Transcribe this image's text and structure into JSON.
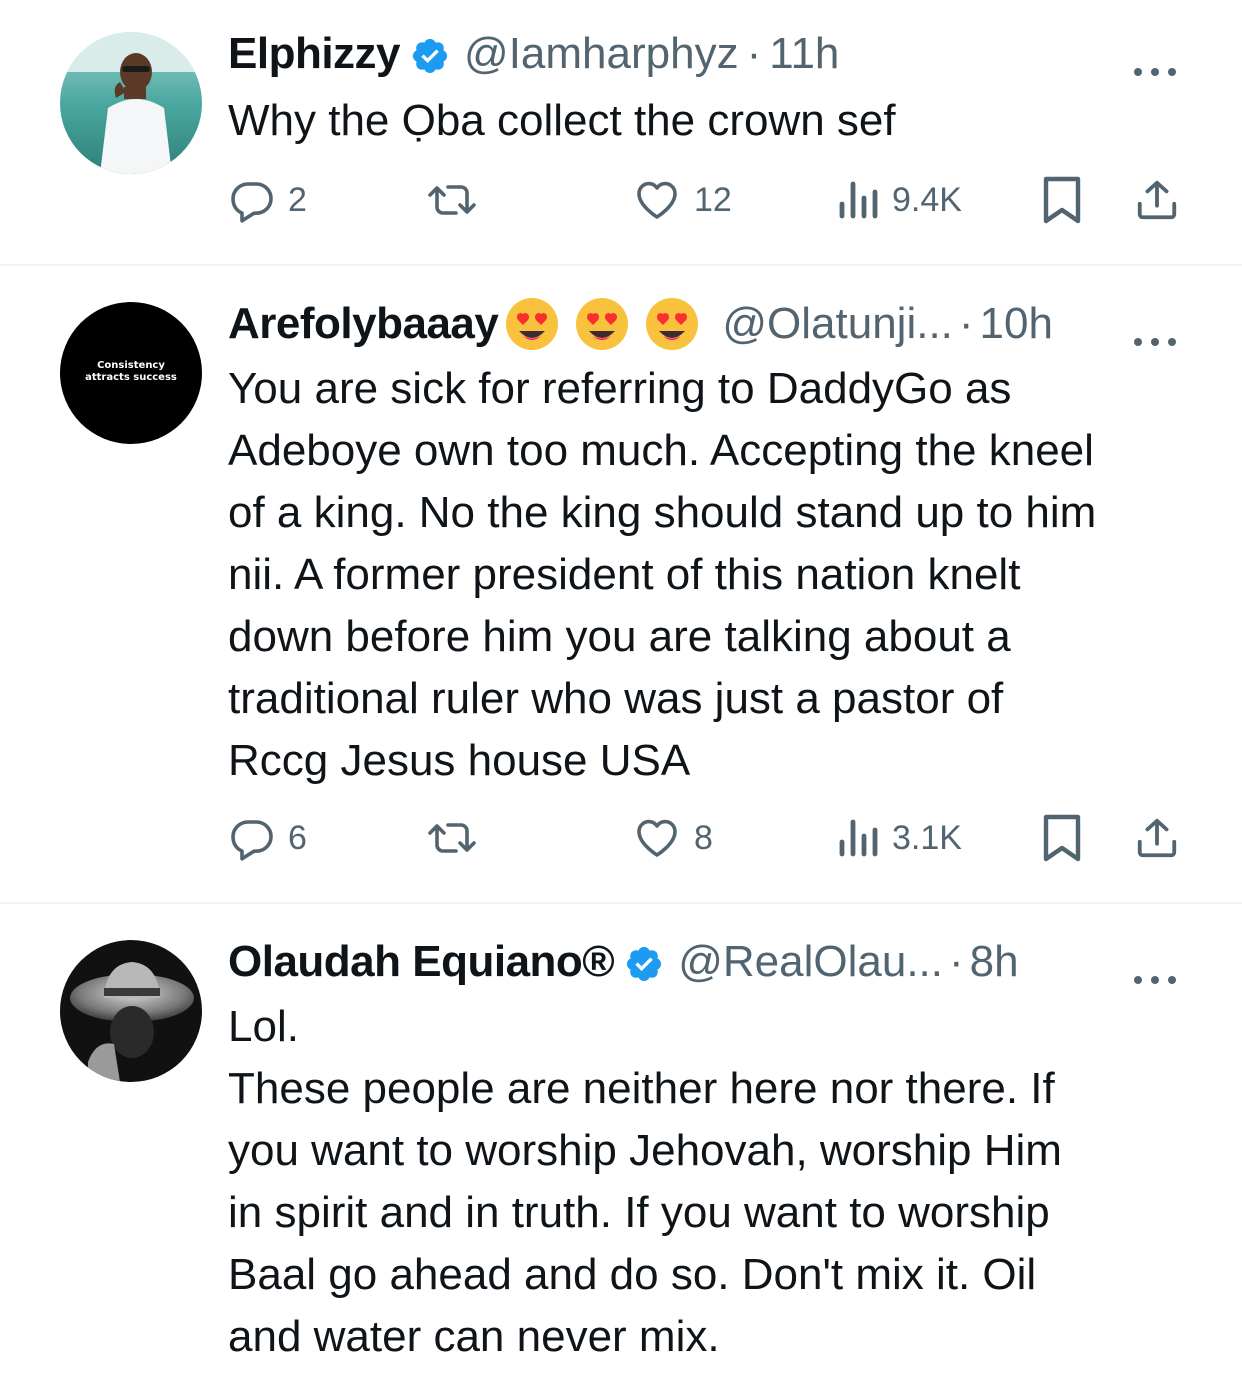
{
  "tweets": [
    {
      "name": "Elphizzy",
      "verified": true,
      "handle": "@Iamharphyz",
      "time": "11h",
      "text": "Why the Ọba collect the crown sef",
      "replies": "2",
      "retweets": "",
      "likes": "12",
      "views": "9.4K"
    },
    {
      "name": "Arefolybaaay",
      "emojis": [
        "heart-eyes-emoji",
        "heart-eyes-emoji",
        "heart-eyes-emoji"
      ],
      "handle": "@Olatunji...",
      "time": "10h",
      "avatar_text": "Consistency\nattracts success",
      "text": "You are sick for referring to DaddyGo as\nAdeboye own too much. Accepting the kneel\nof a king. No the king should stand up to him\nnii. A former president of this nation knelt\ndown before him you are talking about a\ntraditional ruler who was just a pastor of\nRccg Jesus house USA",
      "replies": "6",
      "retweets": "",
      "likes": "8",
      "views": "3.1K"
    },
    {
      "name": "Olaudah Equiano®",
      "verified": true,
      "handle": "@RealOlau...",
      "time": "8h",
      "text": "Lol.\nThese people are neither here nor there. If\nyou want to worship Jehovah, worship Him\nin spirit and in truth. If you want to worship\nBaal go ahead and do so. Don't mix it. Oil\nand water can never mix."
    }
  ],
  "separator": "·",
  "colors": {
    "text": "#0f1419",
    "secondary": "#536471",
    "verified": "#1d9bf0",
    "divider": "#eff3f4"
  }
}
